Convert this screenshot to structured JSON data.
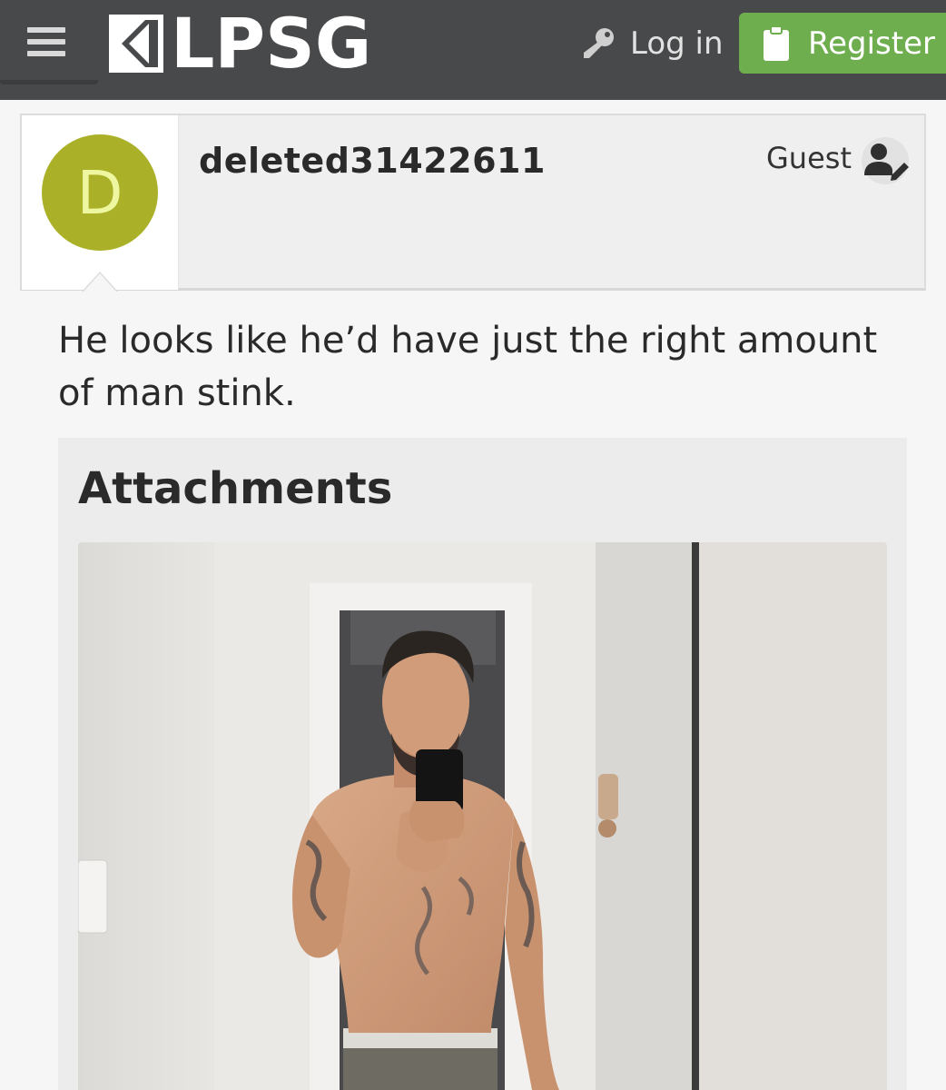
{
  "header": {
    "logo_text": "LPSG",
    "login_label": "Log in",
    "register_label": "Register",
    "colors": {
      "bar": "#47494b",
      "register": "#6fae4f"
    }
  },
  "post": {
    "avatar_letter": "D",
    "avatar_color": "#aab128",
    "username": "deleted31422611",
    "user_title": "Guest",
    "message": "He looks like he’d have just the right amount of man stink."
  },
  "attachments": {
    "heading": "Attachments"
  }
}
